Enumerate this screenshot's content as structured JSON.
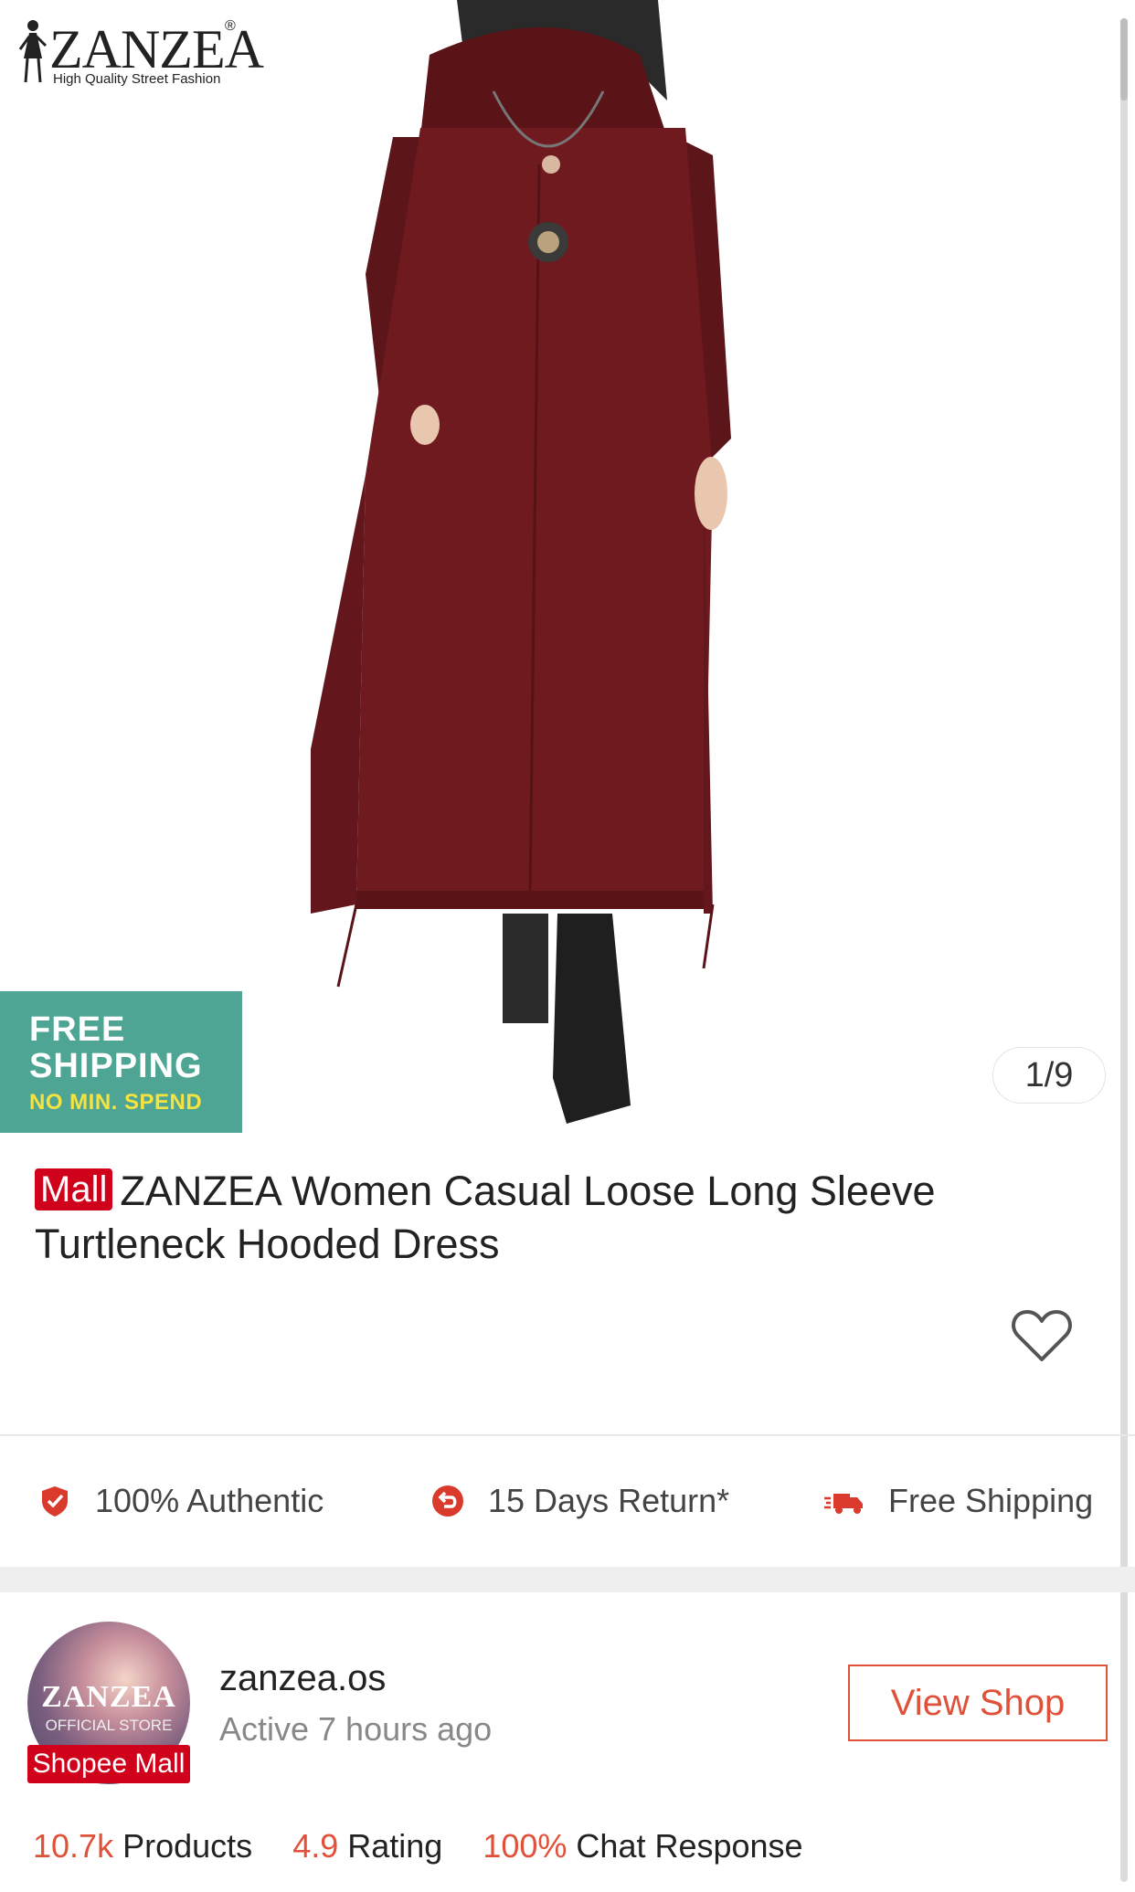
{
  "brand": {
    "name": "ZANZEA",
    "registered": "®",
    "tagline": "High Quality Street Fashion"
  },
  "badge": {
    "line1": "FREE",
    "line2": "SHIPPING",
    "line3": "NO MIN. SPEND"
  },
  "image_counter": "1/9",
  "product": {
    "mall_tag": "Mall",
    "title": "ZANZEA Women Casual Loose Long Sleeve Turtleneck Hooded Dress"
  },
  "guarantees": [
    {
      "label": "100% Authentic",
      "icon": "shield-check-icon"
    },
    {
      "label": "15 Days Return*",
      "icon": "return-icon"
    },
    {
      "label": "Free Shipping",
      "icon": "truck-icon"
    }
  ],
  "shop": {
    "avatar_name": "ZANZEA",
    "avatar_sub": "OFFICIAL STORE",
    "mall_label": "Shopee Mall",
    "name": "zanzea.os",
    "active": "Active 7 hours ago",
    "view_button": "View Shop",
    "stats": {
      "products_value": "10.7k",
      "products_label": "Products",
      "rating_value": "4.9",
      "rating_label": "Rating",
      "chat_value": "100%",
      "chat_label": "Chat Response"
    }
  },
  "colors": {
    "accent": "#e0513a",
    "mall_red": "#d0011b",
    "badge_green": "#4ea594",
    "dress": "#6e1a1f"
  }
}
